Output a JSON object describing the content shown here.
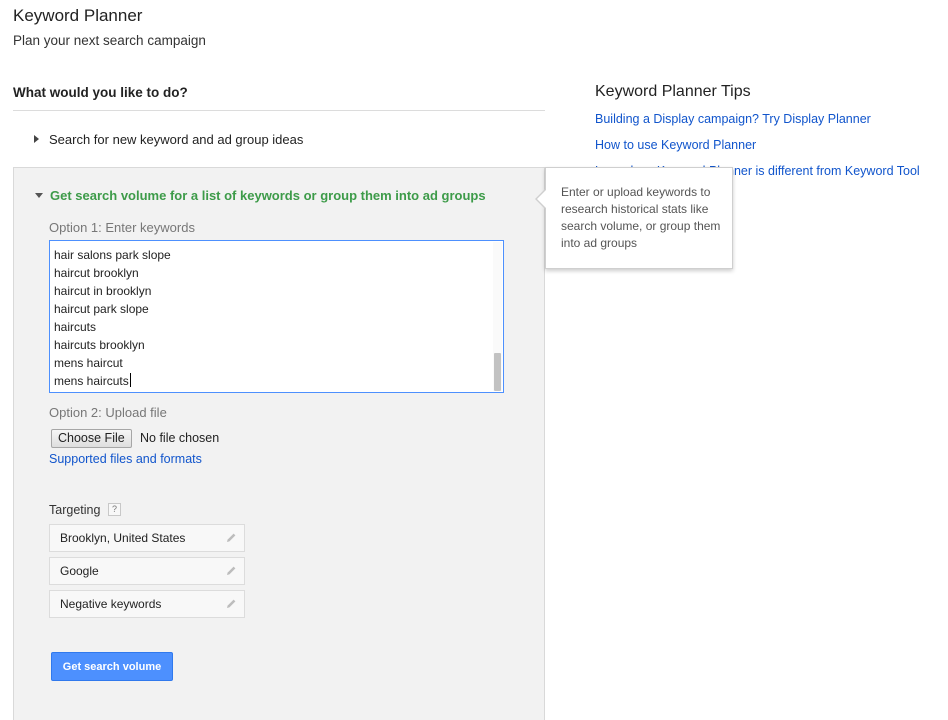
{
  "header": {
    "title": "Keyword Planner",
    "subtitle": "Plan your next search campaign"
  },
  "main": {
    "question": "What would you like to do?",
    "option_collapsed": "Search for new keyword and ad group ideas",
    "option_expanded": "Get search volume for a list of keywords or group them into ad groups",
    "option1_label": "Option 1: Enter keywords",
    "keywords": [
      "hair salons park slope",
      "haircut brooklyn",
      "haircut in brooklyn",
      "haircut park slope",
      "haircuts",
      "haircuts brooklyn",
      "mens haircut",
      "mens haircuts"
    ],
    "option2_label": "Option 2: Upload file",
    "choose_file": "Choose File",
    "no_file": "No file chosen",
    "supported_link": "Supported files and formats",
    "targeting_label": "Targeting",
    "targeting_help": "?",
    "targeting": [
      "Brooklyn, United States",
      "Google",
      "Negative keywords"
    ],
    "submit": "Get search volume"
  },
  "tooltip": {
    "text": "Enter or upload keywords to research historical stats like search volume, or group them into ad groups"
  },
  "tips": {
    "title": "Keyword Planner Tips",
    "links": [
      "Building a Display campaign? Try Display Planner",
      "How to use Keyword Planner",
      "Learn how Keyword Planner is different from Keyword Tool"
    ]
  },
  "colors": {
    "accent_green": "#3d9b49",
    "link_blue": "#1155cc",
    "primary_blue": "#4d90fe"
  }
}
